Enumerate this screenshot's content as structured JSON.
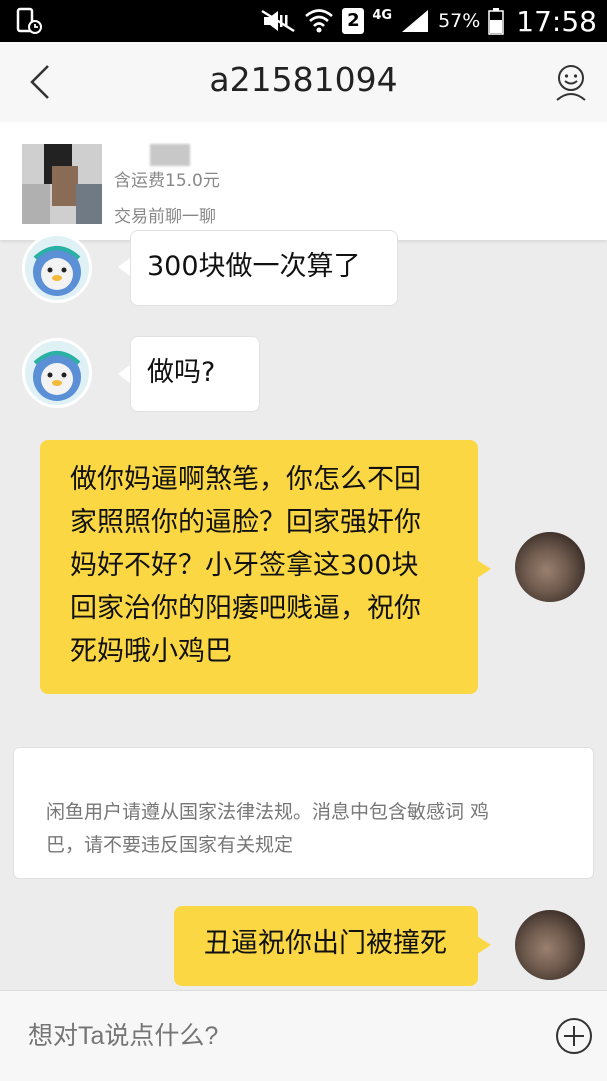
{
  "status_bar": {
    "battery_percent": "57%",
    "time": "17:58",
    "sim_slot": "2",
    "network": "4G",
    "icons": [
      "screenshot-icon",
      "mute-icon",
      "wifi-icon",
      "sim-icon",
      "signal-icon",
      "battery-icon"
    ]
  },
  "header": {
    "title": "a21581094",
    "back_icon": "chevron-left-icon",
    "profile_icon": "user-profile-icon"
  },
  "item": {
    "shipping": "含运费15.0元",
    "hint": "交易前聊一聊"
  },
  "messages": [
    {
      "direction": "in",
      "text": "300块做一次算了"
    },
    {
      "direction": "in",
      "text": "做吗?"
    },
    {
      "direction": "out",
      "lines": [
        "做你妈逼啊煞笔，你怎么不回",
        "家照照你的逼脸？回家强奸你",
        "妈好不好？小牙签拿这300块",
        "回家治你的阳痿吧贱逼，祝你",
        "死妈哦小鸡巴"
      ]
    },
    {
      "direction": "out",
      "text": "丑逼祝你出门被撞死"
    }
  ],
  "system_notice": {
    "lines": [
      "闲鱼用户请遵从国家法律法规。消息中包含敏感词 鸡",
      "巴，请不要违反国家有关规定"
    ]
  },
  "input": {
    "placeholder": "想对Ta说点什么?"
  },
  "colors": {
    "outgoing_bubble": "#fbd843",
    "incoming_bubble": "#ffffff",
    "background": "#ececec"
  }
}
